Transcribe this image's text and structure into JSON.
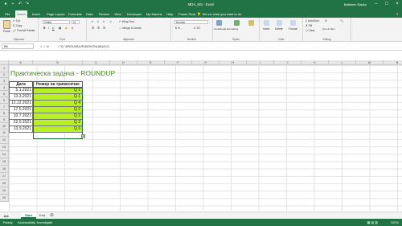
{
  "window": {
    "title": "MDA_s01 - Excel",
    "user": "Batishev Radko"
  },
  "tabs": [
    "File",
    "Home",
    "Insert",
    "Page Layout",
    "Formulas",
    "Data",
    "Review",
    "View",
    "Developer",
    "My Macros",
    "Help",
    "Power Pivot"
  ],
  "active_tab": "Home",
  "tell_me": "Tell me what you want to do",
  "ribbon": {
    "clipboard": {
      "label": "Clipboard",
      "paste": "Paste",
      "cut": "Cut",
      "copy": "Copy",
      "painter": "Format Painter"
    },
    "font": {
      "label": "Font",
      "name": "Calibri",
      "size": "11"
    },
    "alignment": {
      "label": "Alignment",
      "wrap": "Wrap Text",
      "merge": "Merge & Center"
    },
    "number": {
      "label": "Number",
      "format": "Number"
    },
    "styles": {
      "label": "Styles",
      "conditional": "Conditional Formatting",
      "format_table": "Format as Table",
      "cell_styles": "Cell Styles"
    },
    "cells": {
      "label": "Cells",
      "insert": "Insert",
      "delete": "Delete",
      "format": "Format"
    },
    "editing": {
      "label": "Editing",
      "autosum": "AutoSum",
      "fill": "Fill",
      "clear": "Clear",
      "sort": "Sort & Filter",
      "find": "Find & Select"
    }
  },
  "formula_bar": {
    "name_box": "B6",
    "fx": "fx",
    "formula": "=\"Q \"&ROUNDUP(MONTH(A6)/3,0)"
  },
  "columns": [
    "A",
    "B",
    "C",
    "D",
    "E",
    "F",
    "G",
    "H",
    "I",
    "J",
    "K",
    "L",
    "M",
    "N"
  ],
  "rows": [
    "1",
    "2",
    "3",
    "4",
    "5",
    "6",
    "7",
    "8",
    "9",
    "10",
    "11",
    "12",
    "13",
    "14",
    "15",
    "16",
    "17",
    "18",
    "19",
    "20"
  ],
  "sheet": {
    "title": "Практическа задача - ROUNDUP",
    "header_date": "Дата",
    "header_q": "Номер на тримесечие",
    "data": [
      {
        "date": "5.1.2021",
        "q": "Q 1"
      },
      {
        "date": "13.3.2021",
        "q": "Q 1"
      },
      {
        "date": "12.12.2021",
        "q": "Q 4"
      },
      {
        "date": "17.5.2021",
        "q": "Q 2"
      },
      {
        "date": "10.7.2021",
        "q": "Q 3"
      },
      {
        "date": "22.6.2021",
        "q": "Q 2"
      },
      {
        "date": "13.9.2021",
        "q": "Q 3"
      }
    ]
  },
  "sheet_tabs": [
    "Start",
    "End"
  ],
  "active_sheet": "Start",
  "status": {
    "ready": "Ready",
    "accessibility": "Accessibility: Investigate",
    "zoom": "100%"
  },
  "colors": {
    "excel_green": "#217346",
    "cell_fill": "#b6f222",
    "title_green": "#4f8a2b"
  }
}
